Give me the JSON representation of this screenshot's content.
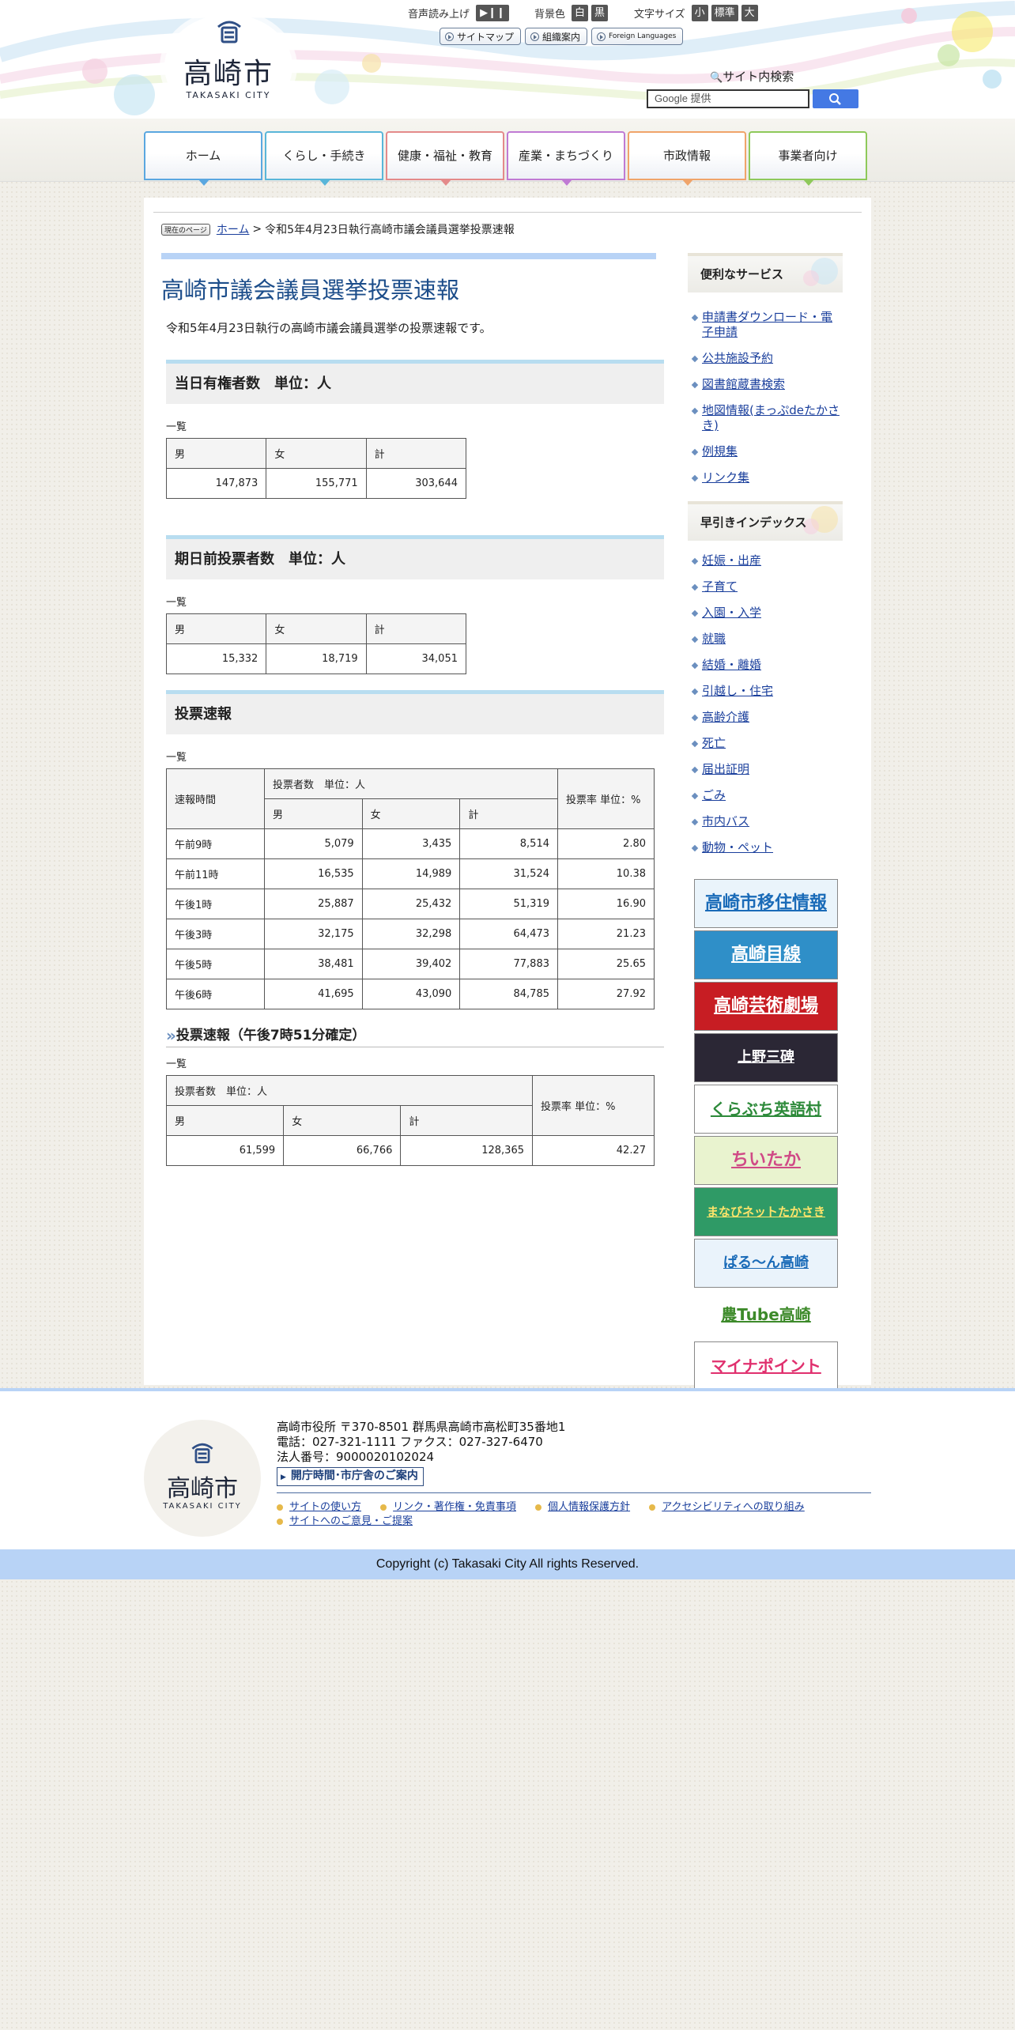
{
  "header": {
    "logo_name": "高崎市",
    "logo_en": "TAKASAKI CITY",
    "voice_label": "音声読み上げ",
    "voice_button": "▶❙❙",
    "bg_label": "背景色",
    "bg_white": "白",
    "bg_black": "黒",
    "font_label": "文字サイズ",
    "font_small": "小",
    "font_standard": "標準",
    "font_large": "大",
    "sitemap": "サイトマップ",
    "org": "組織案内",
    "foreign": "Foreign Languages",
    "search_title": "サイト内検索",
    "search_placeholder": "Google 提供"
  },
  "nav": [
    {
      "label": "ホーム",
      "color": "#5aa7e0"
    },
    {
      "label": "くらし・手続き",
      "color": "#59b6d9"
    },
    {
      "label": "健康・福祉・教育",
      "color": "#e48a8a"
    },
    {
      "label": "産業・まちづくり",
      "color": "#c07ad4"
    },
    {
      "label": "市政情報",
      "color": "#f0a46a"
    },
    {
      "label": "事業者向け",
      "color": "#8ec95a"
    }
  ],
  "breadcrumb": {
    "here_label": "現在のページ",
    "home": "ホーム",
    "separator": ">",
    "current": "令和5年4月23日執行高崎市議会議員選挙投票速報"
  },
  "main": {
    "title": "高崎市議会議員選挙投票速報",
    "intro": "令和5年4月23日執行の高崎市議会議員選挙の投票速報です。",
    "section1": {
      "heading": "当日有権者数　単位：人",
      "caption": "一覧",
      "headers": [
        "男",
        "女",
        "計"
      ],
      "values": [
        "147,873",
        "155,771",
        "303,644"
      ]
    },
    "section2": {
      "heading": "期日前投票者数　単位：人",
      "caption": "一覧",
      "headers": [
        "男",
        "女",
        "計"
      ],
      "values": [
        "15,332",
        "18,719",
        "34,051"
      ]
    },
    "section3": {
      "heading": "投票速報",
      "caption": "一覧",
      "h_time": "速報時間",
      "h_voters": "投票者数　単位：人",
      "h_rate": "投票率 単位：%",
      "h_sub": [
        "男",
        "女",
        "計"
      ],
      "rows": [
        [
          "午前9時",
          "5,079",
          "3,435",
          "8,514",
          "2.80"
        ],
        [
          "午前11時",
          "16,535",
          "14,989",
          "31,524",
          "10.38"
        ],
        [
          "午後1時",
          "25,887",
          "25,432",
          "51,319",
          "16.90"
        ],
        [
          "午後3時",
          "32,175",
          "32,298",
          "64,473",
          "21.23"
        ],
        [
          "午後5時",
          "38,481",
          "39,402",
          "77,883",
          "25.65"
        ],
        [
          "午後6時",
          "41,695",
          "43,090",
          "84,785",
          "27.92"
        ]
      ]
    },
    "section4": {
      "heading": "投票速報（午後7時51分確定）",
      "caption": "一覧",
      "h_voters": "投票者数　単位：人",
      "h_rate": "投票率 単位：%",
      "h_sub": [
        "男",
        "女",
        "計"
      ],
      "values": [
        "61,599",
        "66,766",
        "128,365",
        "42.27"
      ]
    }
  },
  "side": {
    "services_title": "便利なサービス",
    "services": [
      "申請書ダウンロード・電子申請",
      "公共施設予約",
      "図書館蔵書検索",
      "地図情報(まっぷdeたかさき)",
      "例規集",
      "リンク集"
    ],
    "index_title": "早引きインデックス",
    "index": [
      "妊娠・出産",
      "子育て",
      "入園・入学",
      "就職",
      "結婚・離婚",
      "引越し・住宅",
      "高齢介護",
      "死亡",
      "届出証明",
      "ごみ",
      "市内バス",
      "動物・ペット"
    ],
    "banners": [
      {
        "text": "高崎市移住情報",
        "bg": "#eaf4fb",
        "fg": "#1a6bb8"
      },
      {
        "text": "高崎目線",
        "bg": "#2f8fc8",
        "fg": "#ffffff"
      },
      {
        "text": "高崎芸術劇場",
        "bg": "#c71d23",
        "fg": "#ffffff"
      },
      {
        "text": "上野三碑",
        "bg": "#2b2735",
        "fg": "#ffffff"
      },
      {
        "text": "くらぶち英語村",
        "bg": "#ffffff",
        "fg": "#2d8a3a"
      },
      {
        "text": "ちいたか",
        "bg": "#e9f3cf",
        "fg": "#d04a86"
      },
      {
        "text": "まなびネットたかさき",
        "bg": "#2f9a66",
        "fg": "#ffe46a"
      },
      {
        "text": "ぱる～ん高崎",
        "bg": "#eaf3fb",
        "fg": "#1a6bb8"
      },
      {
        "text": "農Tube高崎",
        "bg": "#ffffff",
        "fg": "#3d8a2a"
      },
      {
        "text": "マイナポイント",
        "bg": "#ffffff",
        "fg": "#e0306e"
      }
    ]
  },
  "footer": {
    "logo_name": "高崎市",
    "logo_en": "TAKASAKI CITY",
    "address": "高崎市役所 〒370-8501 群馬県高崎市高松町35番地1",
    "phone": "電話：027-321-1111 ファクス：027-327-6470",
    "corp": "法人番号：9000020102024",
    "hours": "開庁時間･市庁舎のご案内",
    "links": [
      "サイトの使い方",
      "リンク・著作権・免責事項",
      "個人情報保護方針",
      "アクセシビリティへの取り組み",
      "サイトへのご意見・ご提案"
    ],
    "copyright": "Copyright (c) Takasaki City All rights Reserved."
  }
}
